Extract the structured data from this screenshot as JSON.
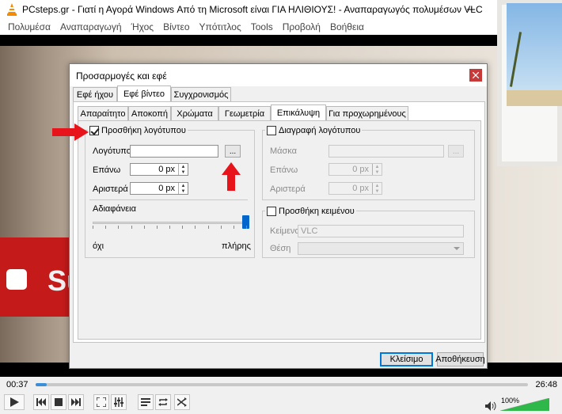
{
  "window": {
    "title": "PCsteps.gr - Γιατί η Αγορά Windows Από τη Microsoft είναι ΓΙΑ ΗΛΙΘΙΟΥΣ! - Αναπαραγωγός πολυμέσων VLC",
    "minimize_icon": "minimize-icon",
    "maximize_icon": "maximize-icon",
    "close_icon": "close-icon"
  },
  "menu": [
    "Πολυμέσα",
    "Αναπαραγωγή",
    "Ήχος",
    "Βίντεο",
    "Υπότιτλος",
    "Tools",
    "Προβολή",
    "Βοήθεια"
  ],
  "video": {
    "overlay_text": "Su"
  },
  "dialog": {
    "title": "Προσαρμογές και εφέ",
    "main_tabs": [
      "Εφέ ήχου",
      "Εφέ βίντεο",
      "Συγχρονισμός"
    ],
    "active_main_tab": "Εφέ βίντεο",
    "sub_tabs": [
      "Απαραίτητο",
      "Αποκοπή",
      "Χρώματα",
      "Γεωμετρία",
      "Επικάλυψη",
      "Για προχωρημένους"
    ],
    "active_sub_tab": "Επικάλυψη",
    "add_logo": {
      "label": "Προσθήκη λογότυπου",
      "checked": true,
      "logo_label": "Λογότυπο",
      "logo_value": "",
      "browse_label": "...",
      "top_label": "Επάνω",
      "top_value": "0 px",
      "left_label": "Αριστερά",
      "left_value": "0 px",
      "opacity_label": "Αδιαφάνεια",
      "opacity_value": 1.0,
      "opacity_min_label": "όχι",
      "opacity_max_label": "πλήρης"
    },
    "remove_logo": {
      "label": "Διαγραφή λογότυπου",
      "checked": false,
      "mask_label": "Μάσκα",
      "mask_value": "",
      "browse_label": "...",
      "top_label": "Επάνω",
      "top_value": "0 px",
      "left_label": "Αριστερά",
      "left_value": "0 px"
    },
    "add_text": {
      "label": "Προσθήκη κειμένου",
      "checked": false,
      "text_label": "Κείμενο",
      "text_value": "VLC",
      "position_label": "Θέση",
      "position_value": ""
    },
    "close_button": "Κλείσιμο",
    "save_button": "Αποθήκευση"
  },
  "player": {
    "elapsed": "00:37",
    "total": "26:48",
    "progress": 0.023,
    "volume_label": "100%",
    "volume": 1.0
  },
  "colors": {
    "accent": "#0066cc",
    "annotation_red": "#e8141b",
    "dialog_close": "#c73a3a",
    "volume_fill": "#2fb84a"
  }
}
